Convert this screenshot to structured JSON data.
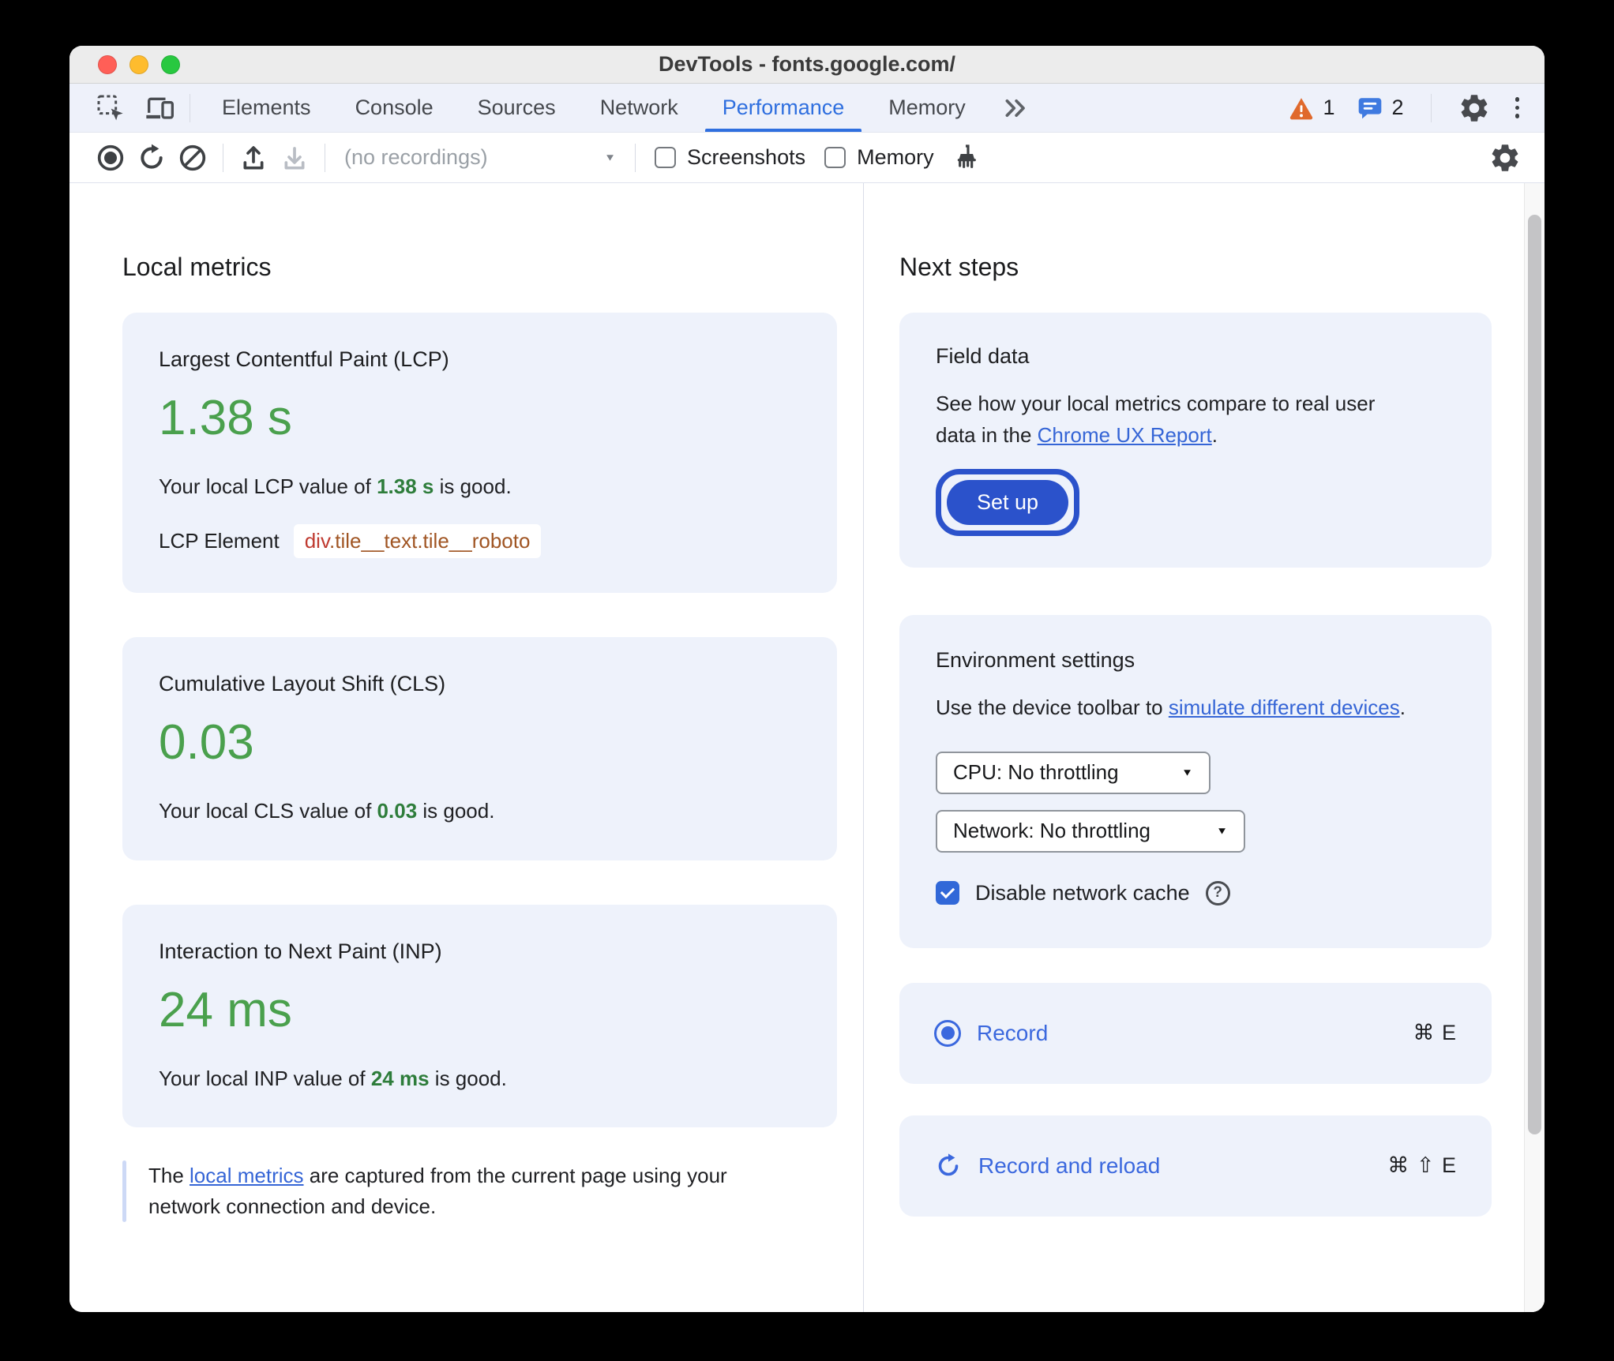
{
  "window": {
    "title": "DevTools - fonts.google.com/"
  },
  "tab_bar": {
    "tabs": [
      {
        "label": "Elements"
      },
      {
        "label": "Console"
      },
      {
        "label": "Sources"
      },
      {
        "label": "Network"
      },
      {
        "label": "Performance"
      },
      {
        "label": "Memory"
      }
    ],
    "active_tab": "Performance",
    "warning_count": "1",
    "message_count": "2"
  },
  "toolbar": {
    "recordings_select": "(no recordings)",
    "screenshots_label": "Screenshots",
    "memory_label": "Memory"
  },
  "local_metrics": {
    "heading": "Local metrics",
    "lcp": {
      "title": "Largest Contentful Paint (LCP)",
      "value": "1.38 s",
      "desc_prefix": "Your local LCP value of ",
      "desc_value": "1.38 s",
      "desc_suffix": " is good.",
      "element_label": "LCP Element",
      "element_tag": "div",
      "element_classes": ".tile__text.tile__roboto"
    },
    "cls": {
      "title": "Cumulative Layout Shift (CLS)",
      "value": "0.03",
      "desc_prefix": "Your local CLS value of ",
      "desc_value": "0.03",
      "desc_suffix": " is good."
    },
    "inp": {
      "title": "Interaction to Next Paint (INP)",
      "value": "24 ms",
      "desc_prefix": "Your local INP value of ",
      "desc_value": "24 ms",
      "desc_suffix": " is good."
    },
    "footnote": {
      "prefix": "The ",
      "link": "local metrics",
      "suffix": " are captured from the current page using your network connection and device."
    }
  },
  "next_steps": {
    "heading": "Next steps",
    "field_data": {
      "title": "Field data",
      "body_prefix": "See how your local metrics compare to real user data in the ",
      "link": "Chrome UX Report",
      "body_suffix": ".",
      "setup_button": "Set up"
    },
    "environment": {
      "title": "Environment settings",
      "body_prefix": "Use the device toolbar to ",
      "link": "simulate different devices",
      "body_suffix": ".",
      "cpu_select": "CPU: No throttling",
      "network_select": "Network: No throttling",
      "cache_checkbox_label": "Disable network cache"
    },
    "record_row": {
      "label": "Record",
      "shortcut": "⌘ E"
    },
    "record_reload_row": {
      "label": "Record and reload",
      "shortcut": "⌘ ⇧ E"
    }
  },
  "colors": {
    "good_green": "#4aa04d",
    "good_green_inline": "#2e7d3b",
    "link_blue": "#3565d6",
    "active_tab_blue": "#2f6fdf",
    "primary_button_blue": "#2b52cb",
    "warning_orange": "#e0692c",
    "message_blue": "#3f7ae0",
    "card_background": "#eef2fb"
  }
}
